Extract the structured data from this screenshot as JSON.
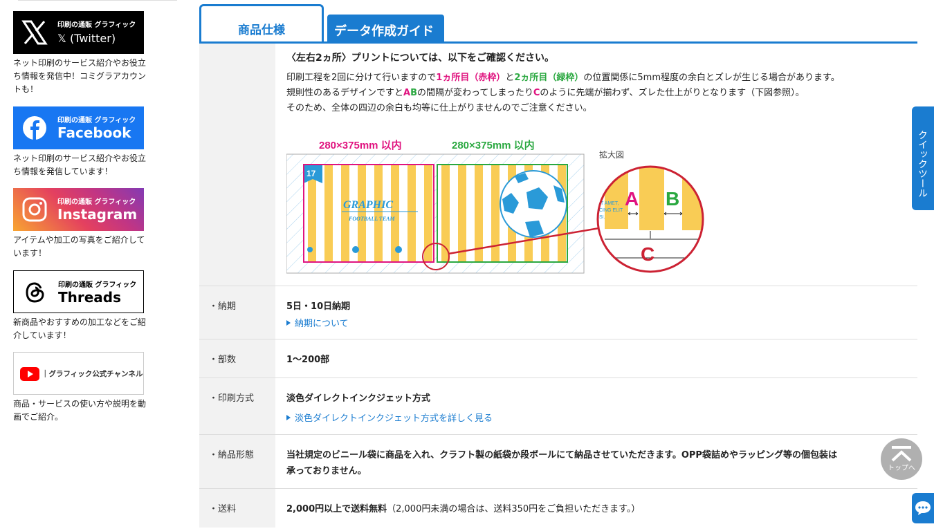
{
  "sidebar": {
    "sns": [
      {
        "brand": "印刷の通販 グラフィック",
        "name": "𝕏 (Twitter)",
        "desc": "ネット印刷のサービス紹介やお役立ち情報を発信中！コミグラアカウントも！"
      },
      {
        "brand": "印刷の通販 グラフィック",
        "name": "Facebook",
        "desc": "ネット印刷のサービス紹介やお役立ち情報を発信しています！"
      },
      {
        "brand": "印刷の通販 グラフィック",
        "name": "Instagram",
        "desc": "アイテムや加工の写真をご紹介しています！"
      },
      {
        "brand": "印刷の通販 グラフィック",
        "name": "Threads",
        "desc": "新商品やおすすめの加工などをご紹介しています！"
      },
      {
        "brand": "",
        "name": "｜グラフィック公式チャンネル",
        "desc": "商品・サービスの使い方や説明を動画でご紹介。"
      }
    ]
  },
  "tabs": {
    "spec": "商品仕様",
    "guide": "データ作成ガイド"
  },
  "print_note": {
    "heading": "〈左右2ヵ所〉プリントについては、以下をご確認ください。",
    "line1_a": "印刷工程を2回に分けて行いますので",
    "line1_pink": "1ヵ所目（赤枠）",
    "line1_b": "と",
    "line1_green": "2ヵ所目（緑枠）",
    "line1_c": "の位置関係に5mm程度の余白とズレが生じる場合があります。",
    "line2_a": "規則性のあるデザインですと",
    "line2_A": "A",
    "line2_B": "B",
    "line2_b": "の間隔が変わってしまったり",
    "line2_C": "C",
    "line2_c": "のように先端が揃わず、ズレた仕上がりとなります（下図参照）。",
    "line3": "そのため、全体の四辺の余白も均等に仕上がりませんのでご注意ください。"
  },
  "diagram": {
    "size_left": "280×375mm 以内",
    "size_right": "280×375mm 以内",
    "zoom_label": "拡大図",
    "badge": "17",
    "graphic_title": "GRAPHIC",
    "graphic_sub": "FOOTBALL TEAM",
    "zoom_text1": "IT AMET,",
    "zoom_text2": "CING ELIT",
    "zoom_text3": "SI.",
    "label_a": "A",
    "label_b": "B",
    "label_c": "C",
    "colors": {
      "pink": "#e0137f",
      "green": "#2aa840",
      "stripe": "#f9cc55",
      "red": "#cc2233",
      "ball": "#2a9ad8"
    }
  },
  "rows": [
    {
      "label": "・納期",
      "value": "5日・10日納期",
      "link": "納期について"
    },
    {
      "label": "・部数",
      "value": "1〜200部"
    },
    {
      "label": "・印刷方式",
      "value": "淡色ダイレクトインクジェット方式",
      "link": "淡色ダイレクトインクジェット方式を詳しく見る"
    },
    {
      "label": "・納品形態",
      "value": "当社規定のビニール袋に商品を入れ、クラフト製の紙袋か段ボールにて納品させていただきます。OPP袋詰めやラッピング等の個包装は",
      "value2": "承っておりません。"
    },
    {
      "label": "・送料",
      "value": "2,000円以上で送料無料",
      "value_note": "（2,000円未満の場合は、送料350円をご負担いただきます。）"
    }
  ],
  "floating": {
    "quick": "クイックツール",
    "totop": "トップへ"
  }
}
